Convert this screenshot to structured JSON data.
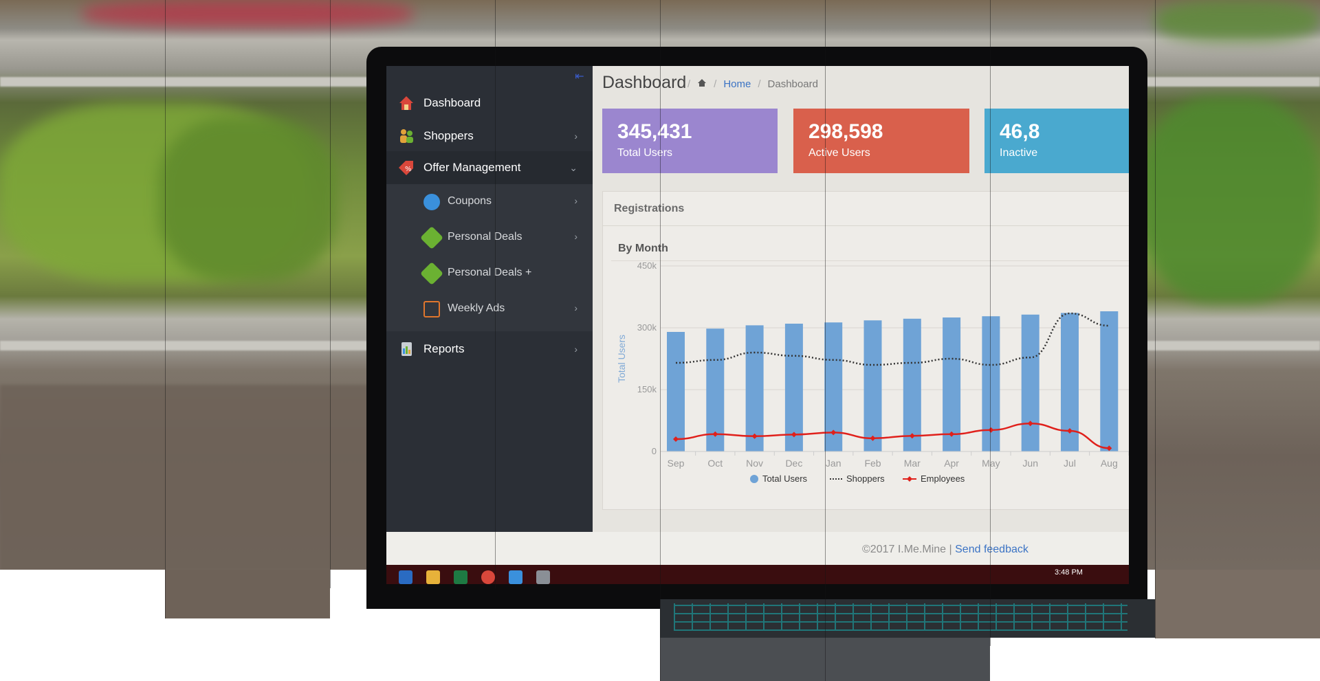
{
  "sidebar": {
    "items": [
      {
        "label": "Dashboard",
        "icon": "house-icon",
        "color": "#d9473b"
      },
      {
        "label": "Shoppers",
        "icon": "people-icon",
        "color": "#e1a23a"
      },
      {
        "label": "Offer Management",
        "icon": "tag-percent-icon",
        "color": "#d9473b"
      },
      {
        "label": "Reports",
        "icon": "clipboard-chart-icon",
        "color": "#7f8a96"
      }
    ],
    "offer_submenu": [
      {
        "label": "Coupons",
        "icon": "coupon-icon",
        "color": "#3a90dc"
      },
      {
        "label": "Personal Deals",
        "icon": "price-tag-icon",
        "color": "#6bb132"
      },
      {
        "label": "Personal Deals +",
        "icon": "price-tag-icon",
        "color": "#6bb132"
      },
      {
        "label": "Weekly Ads",
        "icon": "ad-icon",
        "color": "#e0762d"
      }
    ]
  },
  "header": {
    "title": "Dashboard",
    "breadcrumb": {
      "home": "Home",
      "current": "Dashboard"
    }
  },
  "stats": [
    {
      "value": "345,431",
      "label": "Total Users",
      "color": "#9b86cf"
    },
    {
      "value": "298,598",
      "label": "Active Users",
      "color": "#d9604c"
    },
    {
      "value": "46,8",
      "label": "Inactive",
      "color": "#4aa9cf"
    }
  ],
  "panel": {
    "title": "Registrations",
    "subtitle": "By Month"
  },
  "chart_data": {
    "type": "bar",
    "categories": [
      "Sep",
      "Oct",
      "Nov",
      "Dec",
      "Jan",
      "Feb",
      "Mar",
      "Apr",
      "May",
      "Jun",
      "Jul",
      "Aug"
    ],
    "ylabel": "Total Users",
    "yticks": [
      "450k",
      "300k",
      "150k",
      "0"
    ],
    "ylim": [
      0,
      450000
    ],
    "series": [
      {
        "name": "Total Users",
        "kind": "bar",
        "color": "#6fa3d6",
        "values": [
          290000,
          298000,
          306000,
          310000,
          313000,
          318000,
          322000,
          325000,
          328000,
          332000,
          336000,
          340000
        ]
      },
      {
        "name": "Shoppers",
        "kind": "dotted-line",
        "color": "#333333",
        "values": [
          215000,
          222000,
          240000,
          232000,
          222000,
          210000,
          215000,
          225000,
          210000,
          228000,
          335000,
          305000
        ]
      },
      {
        "name": "Employees",
        "kind": "line",
        "color": "#e0201b",
        "values": [
          30000,
          42000,
          37000,
          41000,
          46000,
          32000,
          38000,
          42000,
          52000,
          68000,
          50000,
          8000
        ]
      }
    ],
    "legend_position": "bottom",
    "grid": true
  },
  "footer": {
    "copyright": "©2017 I.Me.Mine |",
    "link": "Send feedback"
  },
  "taskbar": {
    "time": "3:48 PM"
  }
}
